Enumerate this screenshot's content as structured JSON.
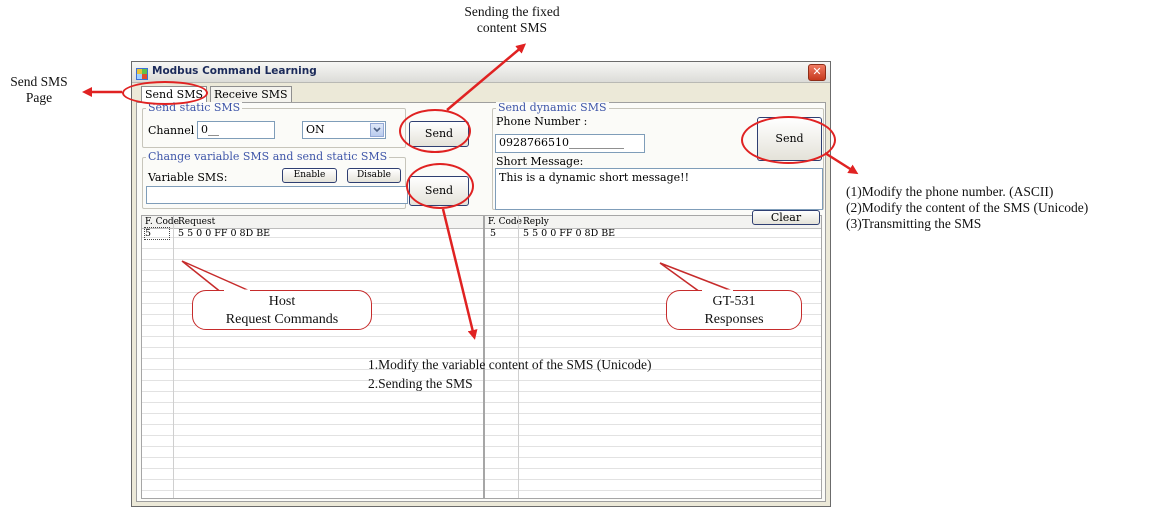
{
  "annotations": {
    "send_sms_page": [
      "Send SMS",
      "Page"
    ],
    "sending_fixed": [
      "Sending the fixed",
      "content SMS"
    ],
    "right_notes": [
      "(1)Modify the phone number. (ASCII)",
      "(2)Modify the content of the SMS (Unicode)",
      "(3)Transmitting the SMS"
    ],
    "variable_notes": [
      "1.Modify the variable content of the SMS (Unicode)",
      "2.Sending the SMS"
    ],
    "host_callout": [
      "Host",
      "Request Commands"
    ],
    "gt_callout": [
      "GT-531",
      "Responses"
    ]
  },
  "window": {
    "title": "Modbus Command Learning",
    "close": "✕"
  },
  "tabs": [
    "Send SMS",
    "Receive SMS"
  ],
  "static_sms": {
    "group_label": "Send static SMS",
    "channel_label": "Channel :",
    "channel_value": "0__",
    "state_value": "ON",
    "send_label": "Send"
  },
  "variable_sms": {
    "group_label": "Change variable SMS and send static SMS",
    "label": "Variable SMS:",
    "enable_label": "Enable",
    "disable_label": "Disable",
    "send_label": "Send",
    "value": ""
  },
  "dynamic_sms": {
    "group_label": "Send dynamic SMS",
    "phone_label": "Phone Number :",
    "phone_value": "0928766510__________",
    "message_label": "Short Message:",
    "message_value": "This is a dynamic short message!!",
    "send_label": "Send"
  },
  "request_table": {
    "headers": [
      "F. Code",
      "Request"
    ],
    "rows": [
      [
        "5",
        "5 5 0 0 FF 0 8D BE"
      ]
    ]
  },
  "reply_table": {
    "headers": [
      "F. Code",
      "Reply"
    ],
    "rows": [
      [
        "5",
        "5 5 0 0 FF 0 8D BE"
      ]
    ],
    "clear_label": "Clear"
  },
  "colors": {
    "annotation_red": "#e02222",
    "group_label_blue": "#3f56a9"
  }
}
